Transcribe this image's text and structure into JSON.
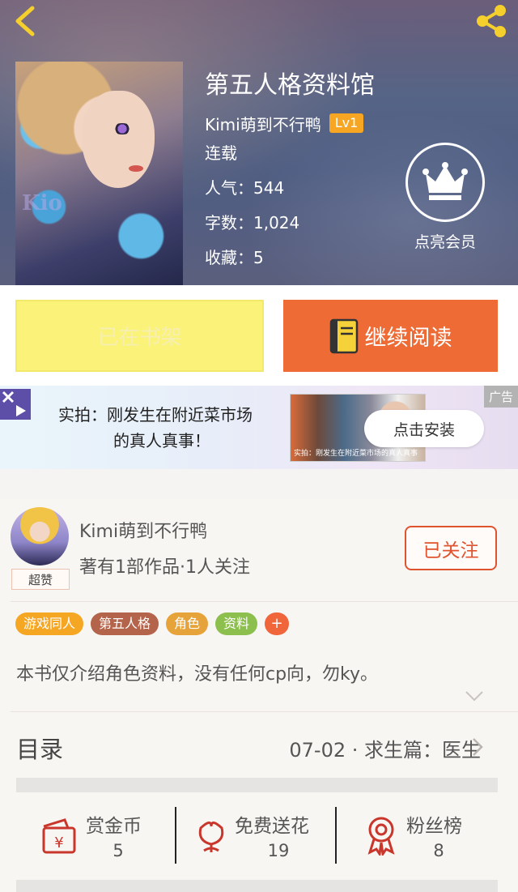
{
  "header": {
    "title": "第五人格资料馆",
    "author": "Kimi萌到不行鸭",
    "level": "Lv1",
    "status": "连载",
    "popularity": "人气：544",
    "word_count": "字数：1,024",
    "favorites": "收藏：5",
    "cover_text": "Kio",
    "vip_label": "点亮会员"
  },
  "actions": {
    "shelf_label": "已在书架",
    "read_label": "继续阅读"
  },
  "ad": {
    "line1": "实拍：刚发生在附近菜市场",
    "line2": "的真人真事！",
    "image_caption": "实拍：刚发生在附近菜市场的真人真事",
    "install_label": "点击安装",
    "tag": "广告"
  },
  "author_card": {
    "name": "Kimi萌到不行鸭",
    "stats": "著有1部作品·1人关注",
    "award": "超赞",
    "follow_label": "已关注"
  },
  "tags": [
    {
      "label": "游戏同人",
      "color": "#f5a623"
    },
    {
      "label": "第五人格",
      "color": "#b3644a"
    },
    {
      "label": "角色",
      "color": "#e6a33a"
    },
    {
      "label": "资料",
      "color": "#8cbf4e"
    }
  ],
  "tag_plus": "+",
  "description": "本书仅介绍角色资料，没有任何cp向，勿ky。",
  "toc": {
    "label": "目录",
    "latest": "07-02 · 求生篇：医生"
  },
  "stats": [
    {
      "label": "赏金币",
      "value": "5",
      "icon": "reward-coin-icon"
    },
    {
      "label": "免费送花",
      "value": "19",
      "icon": "flower-icon"
    },
    {
      "label": "粉丝榜",
      "value": "8",
      "icon": "medal-icon"
    }
  ],
  "colors": {
    "accent": "#ef6b36",
    "shelf": "#fbf27a",
    "follow": "#e0532f",
    "icon_gold": "#f5cf2c",
    "icon_red": "#c9362b"
  }
}
